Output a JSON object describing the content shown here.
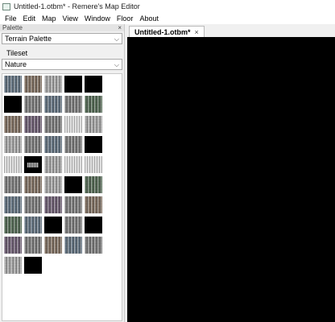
{
  "window": {
    "title": "Untitled-1.otbm* - Remere's Map Editor"
  },
  "menu": [
    "File",
    "Edit",
    "Map",
    "View",
    "Window",
    "Floor",
    "About"
  ],
  "palette": {
    "header": "Palette",
    "close": "×",
    "type_select": "Terrain Palette",
    "tileset_label": "Tileset",
    "tileset_select": "Nature"
  },
  "document": {
    "tab_label": "Untitled-1.otbm*",
    "tab_close": "×"
  },
  "icons": {
    "dropdown": "chevron-down-icon",
    "close": "close-icon"
  },
  "colors": {
    "canvas": "#000000",
    "panel": "#f0f0f0"
  }
}
